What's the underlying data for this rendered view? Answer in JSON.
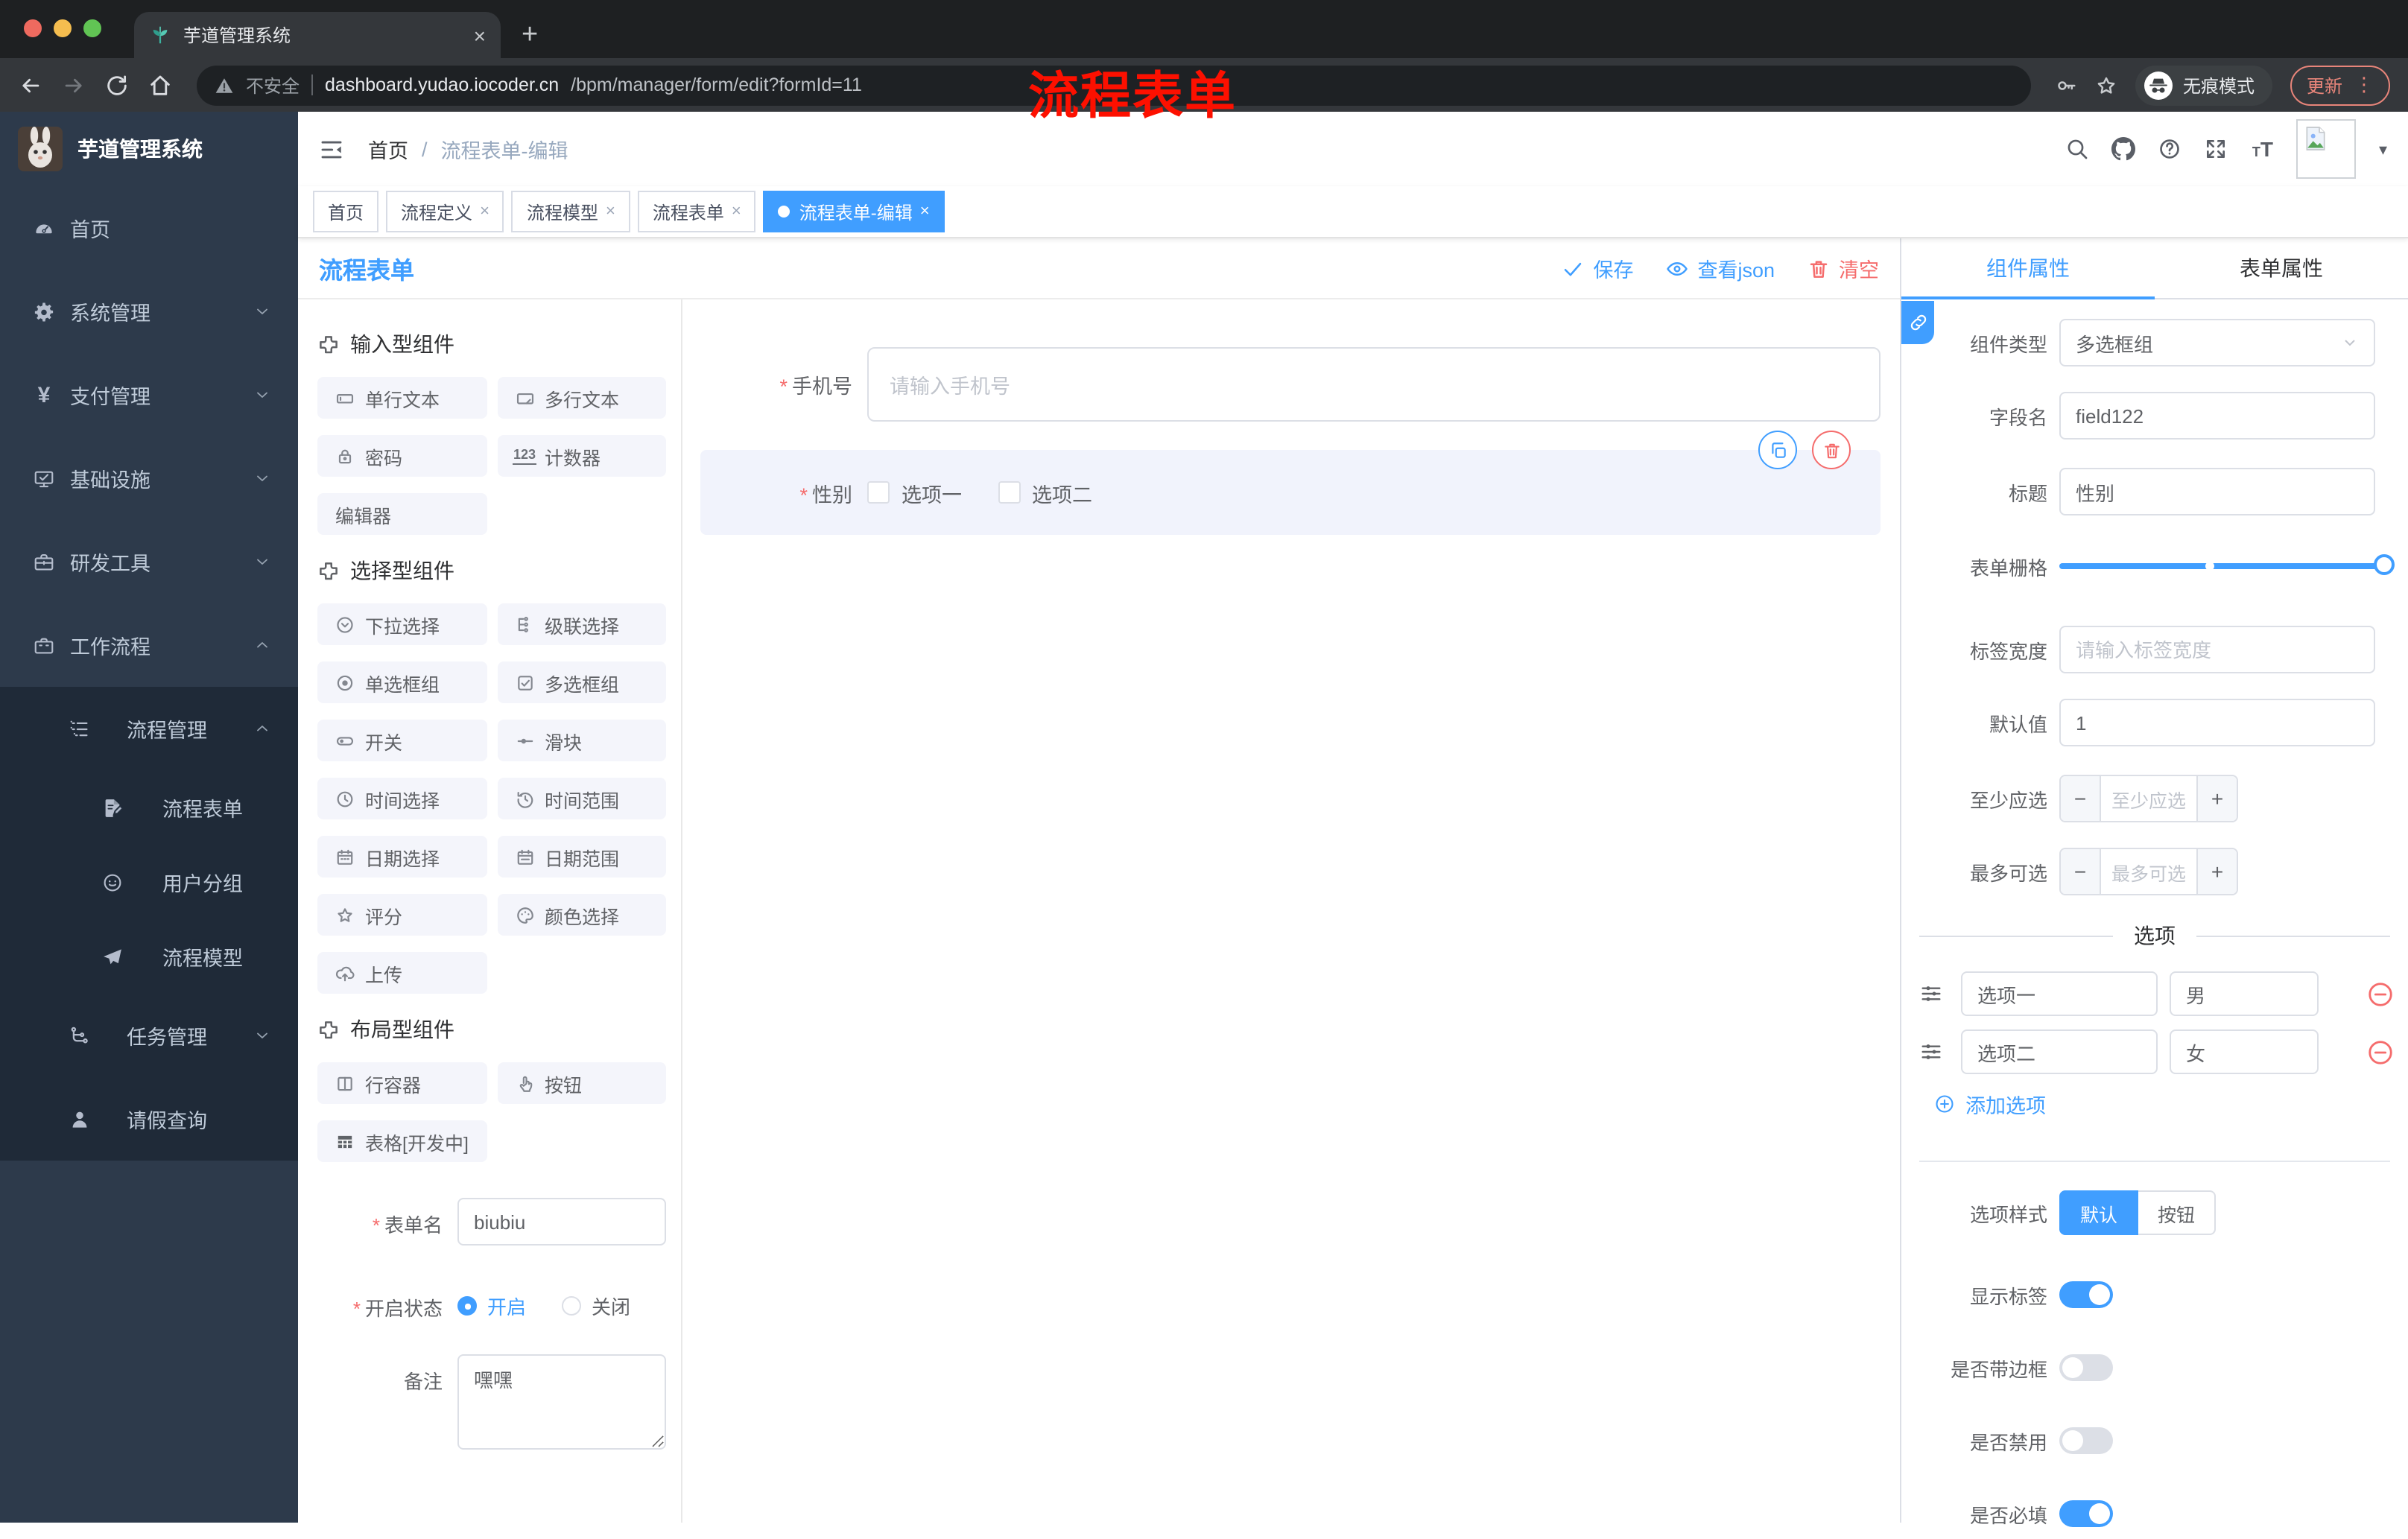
{
  "browser": {
    "tab_title": "芋道管理系统",
    "close_glyph": "×",
    "new_tab_glyph": "+",
    "not_secure": "不安全",
    "url_domain": "dashboard.yudao.iocoder.cn",
    "url_path": "/bpm/manager/form/edit?formId=11",
    "incognito_label": "无痕模式",
    "update_label": "更新",
    "kebab_glyph": "⋮",
    "caret_glyph": "▾",
    "icons": {
      "favicon": "plant",
      "back": "arrow-left",
      "forward": "arrow-right",
      "reload": "reload",
      "home": "home",
      "warning": "warning",
      "key": "key",
      "bookmark": "star-outline",
      "incognito": "incognito"
    }
  },
  "annotation": {
    "text": "流程表单"
  },
  "header": {
    "breadcrumb": {
      "home": "首页",
      "separator": "/",
      "current": "流程表单-编辑"
    },
    "icons": {
      "fold": "fold",
      "search": "search",
      "github": "github",
      "help": "question",
      "fullscreen": "fullscreen",
      "fontsize": "text-size",
      "avatar": "image-placeholder",
      "caret": "▾"
    }
  },
  "tags": {
    "close_glyph": "×",
    "items": [
      {
        "label": "首页",
        "closable": false,
        "active": false
      },
      {
        "label": "流程定义",
        "closable": true,
        "active": false
      },
      {
        "label": "流程模型",
        "closable": true,
        "active": false
      },
      {
        "label": "流程表单",
        "closable": true,
        "active": false
      },
      {
        "label": "流程表单-编辑",
        "closable": true,
        "active": true
      }
    ]
  },
  "sidebar": {
    "title": "芋道管理系统",
    "items": [
      {
        "icon": "dashboard",
        "label": "首页",
        "arrow": ""
      },
      {
        "icon": "gear",
        "label": "系统管理",
        "arrow": "chev-down"
      },
      {
        "icon": "yen",
        "label": "支付管理",
        "arrow": "chev-down"
      },
      {
        "icon": "infra",
        "label": "基础设施",
        "arrow": "chev-down"
      },
      {
        "icon": "tools",
        "label": "研发工具",
        "arrow": "chev-down"
      },
      {
        "icon": "briefcase",
        "label": "工作流程",
        "arrow": "chev-up"
      },
      {
        "icon": "flow-list",
        "label": "流程管理",
        "arrow": "chev-up"
      },
      {
        "icon": "doc-edit",
        "label": "流程表单",
        "arrow": ""
      },
      {
        "icon": "face",
        "label": "用户分组",
        "arrow": ""
      },
      {
        "icon": "plane",
        "label": "流程模型",
        "arrow": ""
      },
      {
        "icon": "tasks",
        "label": "任务管理",
        "arrow": "chev-down"
      },
      {
        "icon": "person",
        "label": "请假查询",
        "arrow": ""
      }
    ]
  },
  "builder": {
    "title": "流程表单",
    "save_label": "保存",
    "view_json_label": "查看json",
    "clear_label": "清空",
    "icons": {
      "save": "check",
      "view": "eye",
      "clear": "trash"
    }
  },
  "palette": {
    "sections": [
      {
        "icon": "puzzle",
        "title": "输入型组件",
        "items": [
          {
            "icon": "input-box",
            "label": "单行文本"
          },
          {
            "icon": "textarea-box",
            "label": "多行文本"
          },
          {
            "icon": "lock",
            "label": "密码"
          },
          {
            "icon": "counter-123",
            "label": "计数器"
          },
          {
            "icon": "",
            "label": "编辑器"
          }
        ]
      },
      {
        "icon": "puzzle",
        "title": "选择型组件",
        "items": [
          {
            "icon": "select-circle",
            "label": "下拉选择"
          },
          {
            "icon": "cascade",
            "label": "级联选择"
          },
          {
            "icon": "radio",
            "label": "单选框组"
          },
          {
            "icon": "checkbox",
            "label": "多选框组"
          },
          {
            "icon": "switch",
            "label": "开关"
          },
          {
            "icon": "slider",
            "label": "滑块"
          },
          {
            "icon": "time",
            "label": "时间选择"
          },
          {
            "icon": "time-range",
            "label": "时间范围"
          },
          {
            "icon": "date",
            "label": "日期选择"
          },
          {
            "icon": "date-range",
            "label": "日期范围"
          },
          {
            "icon": "star",
            "label": "评分"
          },
          {
            "icon": "color",
            "label": "颜色选择"
          },
          {
            "icon": "upload",
            "label": "上传"
          }
        ]
      },
      {
        "icon": "puzzle",
        "title": "布局型组件",
        "items": [
          {
            "icon": "row-container",
            "label": "行容器"
          },
          {
            "icon": "pointer",
            "label": "按钮"
          },
          {
            "icon": "table-grid",
            "label": "表格[开发中]"
          }
        ]
      }
    ]
  },
  "left_form": {
    "name_label": "表单名",
    "name_value": "biubiu",
    "status_label": "开启状态",
    "status_on": "开启",
    "status_off": "关闭",
    "remark_label": "备注",
    "remark_value": "嘿嘿"
  },
  "canvas": {
    "phone_label": "手机号",
    "phone_placeholder": "请输入手机号",
    "gender_label": "性别",
    "gender_opt1": "选项一",
    "gender_opt2": "选项二",
    "icons": {
      "copy": "copy",
      "delete": "trash"
    }
  },
  "panel": {
    "tab_component": "组件属性",
    "tab_form": "表单属性",
    "link_icon": "link",
    "type_label": "组件类型",
    "type_value": "多选框组",
    "field_label": "字段名",
    "field_value": "field122",
    "title_label": "标题",
    "title_value": "性别",
    "grid_label": "表单栅格",
    "width_label": "标签宽度",
    "width_placeholder": "请输入标签宽度",
    "default_label": "默认值",
    "default_value": "1",
    "min_label": "至少应选",
    "min_placeholder": "至少应选",
    "max_label": "最多可选",
    "max_placeholder": "最多可选",
    "minus_glyph": "−",
    "plus_glyph": "+",
    "options_title": "选项",
    "options": [
      {
        "label": "选项一",
        "value": "男"
      },
      {
        "label": "选项二",
        "value": "女"
      }
    ],
    "add_option_label": "添加选项",
    "style_label": "选项样式",
    "style_default": "默认",
    "style_button": "按钮",
    "toggle_show_label": "显示标签",
    "toggle_border_label": "是否带边框",
    "toggle_disabled_label": "是否禁用",
    "toggle_required_label": "是否必填",
    "icons": {
      "drag": "drag-sliders",
      "remove": "minus-circle",
      "add": "plus-circle"
    }
  },
  "colors": {
    "accent": "#409eff",
    "danger": "#f56c6c",
    "sidebar_bg": "#2d3a4b",
    "submenu_bg": "#1f2a38",
    "annotation": "#fd1000"
  }
}
